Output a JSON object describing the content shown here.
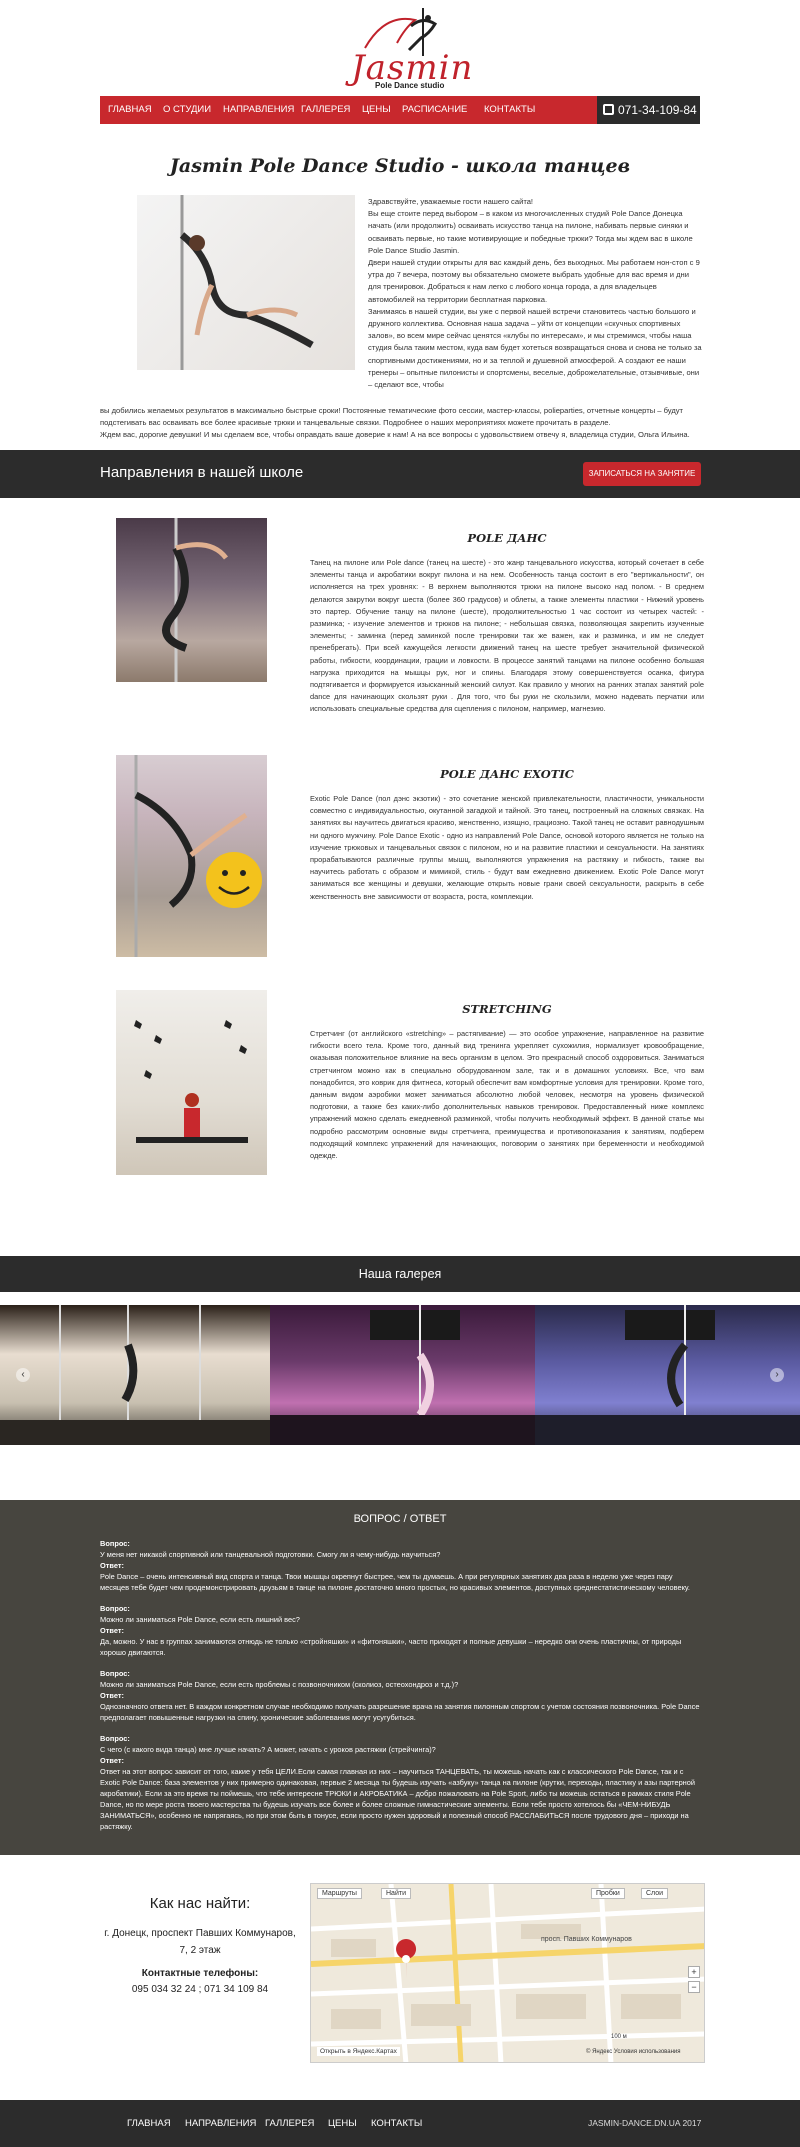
{
  "logo": {
    "word": "Jasmin",
    "sub": "Pole Dance studio"
  },
  "nav": {
    "items": [
      "ГЛАВНАЯ",
      "О СТУДИИ",
      "НАПРАВЛЕНИЯ",
      "ГАЛЛЕРЕЯ",
      "ЦЕНЫ",
      "РАСПИСАНИЕ",
      "КОНТАКТЫ"
    ],
    "phone": "071-34-109-84"
  },
  "intro": {
    "title": "Jasmin Pole Dance Studio - школа танцев",
    "p1": "Здравствуйте, уважаемые гости нашего сайта!",
    "p2": "Вы еще стоите перед выбором – в каком из многочисленных студий Pole Dance Донецка начать (или продолжить) осваивать искусство танца на пилоне, набивать первые синяки и осваивать первые, но такие мотивирующие и победные трюки? Тогда мы ждем вас в школе Pole Dance Studio Jasmin.",
    "p3": "Двери нашей студии открыты для вас каждый день, без выходных. Мы работаем нон-стоп с 9 утра до 7 вечера, поэтому вы обязательно сможете выбрать удобные для вас время и дни для тренировок. Добраться к нам легко с любого конца города, а для владельцев автомобилей на территории бесплатная парковка.",
    "p4": "Занимаясь в нашей студии, вы уже с первой нашей встречи становитесь частью большого и дружного коллектива. Основная наша задача – уйти от концепции «скучных спортивных залов», во всем мире сейчас ценятся «клубы по интересам», и мы стремимся, чтобы наша студия была таким местом, куда вам будет хотеться возвращаться снова и снова не только за спортивными достижениями, но и за теплой и душевной атмосферой. А создают ее наши тренеры – опытные пилонисты и спортсмены, веселые, доброжелательные, отзывчивые, они – сделают все, чтобы",
    "p5": "вы добились желаемых результатов в максимально быстрые сроки! Постоянные тематические фото сессии, мастер-классы, polieparties, отчетные концерты – будут подстегивать вас осваивать все более красивые трюки и танцевальные связки. Подробнее о наших мероприятиях можете прочитать в разделе.",
    "p6": "Ждем вас, дорогие девушки! И мы сделаем все, чтобы оправдать ваше доверие к нам! А на все вопросы с удовольствием отвечу я, владелица студии, Ольга Ильина."
  },
  "directions": {
    "band_title": "Направления в нашей школе",
    "signup": "ЗАПИСАТЬСЯ НА ЗАНЯТИЕ",
    "items": [
      {
        "title": "POLE ДАНС",
        "text": "Танец на пилоне или Pole dance (танец на шесте) - это жанр танцевального искусства, который сочетает в себе элементы танца и акробатики вокруг пилона и на нем. Особенность танца состоит в его \"вертикальности\", он исполняется на трех уровнях: - В верхнем выполняются трюки на пилоне высоко над полом. - В среднем делаются закрутки вокруг шеста (более 360 градусов) и облеты, а также элементы пластики - Нижний уровень это партер. Обучение танцу на пилоне (шесте), продолжительностью 1 час состоит из четырех частей: - разминка; - изучение элементов и трюков на пилоне; - небольшая связка, позволяющая закрепить изученные элементы; - заминка (перед заминкой после тренировки так же важен, как и разминка, и им не следует пренебрегать). При всей кажущейся легкости движений танец на шесте требует значительной физической работы, гибкости, координации, грации и ловкости. В процессе занятий танцами на пилоне особенно большая нагрузка приходится на мышцы рук, ног и спины. Благодаря этому совершенствуется осанка, фигура подтягивается и формируется изысканный женский силуэт. Как правило у многих на ранних этапах занятий pole dance для начинающих скользят руки . Для того, что бы руки не скользили, можно надевать перчатки или использовать специальные средства для сцепления с пилоном, например, магнезию."
      },
      {
        "title": "POLE ДАНС EXOTIC",
        "text": "Exotic Pole Dance (пол дэнс экзотик) - это сочетание женской привлекательности, пластичности, уникальности совместно с индивидуальностью, окутанной загадкой и тайной. Это танец, построенный на сложных связках. На занятиях вы научитесь двигаться красиво, женственно, изящно, грациозно. Такой танец не оставит равнодушным ни одного мужчину. Pole Dance Exotic - одно из направлений Pole Dance, основой которого является не только на изучение трюковых и танцевальных связок с пилоном, но и на развитие пластики и сексуальности. На занятиях прорабатываются различные группы мышц, выполняются упражнения на растяжку и гибкость, также вы научитесь работать с образом и мимикой, стиль - будут вам ежедневно движением. Exotic Pole Dance могут заниматься все женщины и девушки, желающие открыть новые грани своей сексуальности, раскрыть в себе женственность вне зависимости от возраста, роста, комплекции."
      },
      {
        "title": "STRETCHING",
        "text": "Стретчинг (от английского «stretching» – растягивание) — это особое упражнение, направленное на развитие гибкости всего тела. Кроме того, данный вид тренинга укрепляет сухожилия, нормализует кровообращение, оказывая положительное влияние на весь организм в целом. Это прекрасный способ оздоровиться. Заниматься стретчингом можно как в специально оборудованном зале, так и в домашних условиях. Все, что вам понадобится, это коврик для фитнеса, который обеспечит вам комфортные условия для тренировки. Кроме того, данным видом аэробики может заниматься абсолютно любой человек, несмотря на уровень физической подготовки, а также без каких-либо дополнительных навыков тренировок. Предоставленный ниже комплекс упражнений можно сделать ежедневной разминкой, чтобы получить необходимый эффект. В данной статье мы подробно рассмотрим основные виды стретчинга, преимущества и противопоказания к занятиям, подберем подходящий комплекс упражнений для начинающих, поговорим о занятиях при беременности и необходимой одежде."
      }
    ]
  },
  "gallery": {
    "title": "Наша галерея",
    "prev": "‹",
    "next": "›"
  },
  "faq": {
    "title": "ВОПРОС / ОТВЕТ",
    "q_label": "Вопрос:",
    "a_label": "Ответ:",
    "items": [
      {
        "q": "У меня нет никакой спортивной или танцевальной подготовки. Смогу ли я чему-нибудь научиться?",
        "a": "Pole Dance – очень интенсивный вид спорта и танца. Твои мышцы окрепнут быстрее, чем ты думаешь. А при регулярных занятиях два раза в неделю уже через пару месяцев тебе будет чем продемонстрировать друзьям в танце на пилоне достаточно много простых, но красивых элементов, доступных среднестатистическому человеку."
      },
      {
        "q": "Можно ли заниматься Pole Dance, если есть лишний вес?",
        "a": "Да, можно. У нас в группах занимаются отнюдь не только «стройняшки» и «фитоняшки», часто приходят и полные девушки – нередко они очень пластичны, от природы хорошо двигаются."
      },
      {
        "q": "Можно ли заниматься Pole Dance, если есть проблемы с позвоночником (сколиоз, остеохондроз и т.д.)?",
        "a": "Однозначного ответа нет. В каждом конкретном случае необходимо получать разрешение врача на занятия пилонным спортом с учетом состояния позвоночника. Pole Dance предполагает повышенные нагрузки на спину, хронические заболевания могут усугубиться."
      },
      {
        "q": "С чего (с какого вида танца) мне лучше начать? А может, начать с уроков растяжки (стрейчинга)?",
        "a": "Ответ на этот вопрос зависит от того, какие у тебя ЦЕЛИ.Если самая главная из них – научиться ТАНЦЕВАТЬ, ты можешь начать как с классического Pole Dance, так и с Exotic Pole Dance: база элементов у них примерно одинаковая, первые 2 месяца ты будешь изучать «азбуку» танца на пилоне (крутки, переходы, пластику и азы партерной акробатики). Если за это время ты поймешь, что тебе интересне ТРЮКИ и АКРОБАТИКА – добро пожаловать на Pole Sport, либо ты можешь остаться в рамках стиля Pole Dance, но по мере роста твоего мастерства ты будешь изучать все более и более сложные гимнастические элементы. Если тебе просто хотелось бы «ЧЕМ-НИБУДЬ ЗАНИМАТЬСЯ», особенно не напрягаясь, но при этом быть в тонусе, если просто нужен здоровый и полезный способ РАССЛАБИТЬСЯ после трудового дня – приходи на растяжку."
      }
    ]
  },
  "contacts": {
    "title": "Как нас найти:",
    "addr1": "г. Донецк, проспект Павших Коммунаров,",
    "addr2": "7, 2 этаж",
    "phones_label": "Контактные телефоны:",
    "phones": "095 034 32 24 ; 071 34 109 84",
    "map": {
      "routes": "Маршруты",
      "find": "Найти",
      "traffic": "Пробки",
      "layers": "Слои",
      "street": "просп. Павших Коммунаров",
      "open": "Открыть в Яндекс.Картах",
      "copyright": "© Яндекс Условия использования",
      "scale": "100 м"
    }
  },
  "footer": {
    "items": [
      "ГЛАВНАЯ",
      "НАПРАВЛЕНИЯ",
      "ГАЛЛЕРЕЯ",
      "ЦЕНЫ",
      "КОНТАКТЫ"
    ],
    "copyright": "JASMIN-DANCE.DN.UA 2017"
  }
}
